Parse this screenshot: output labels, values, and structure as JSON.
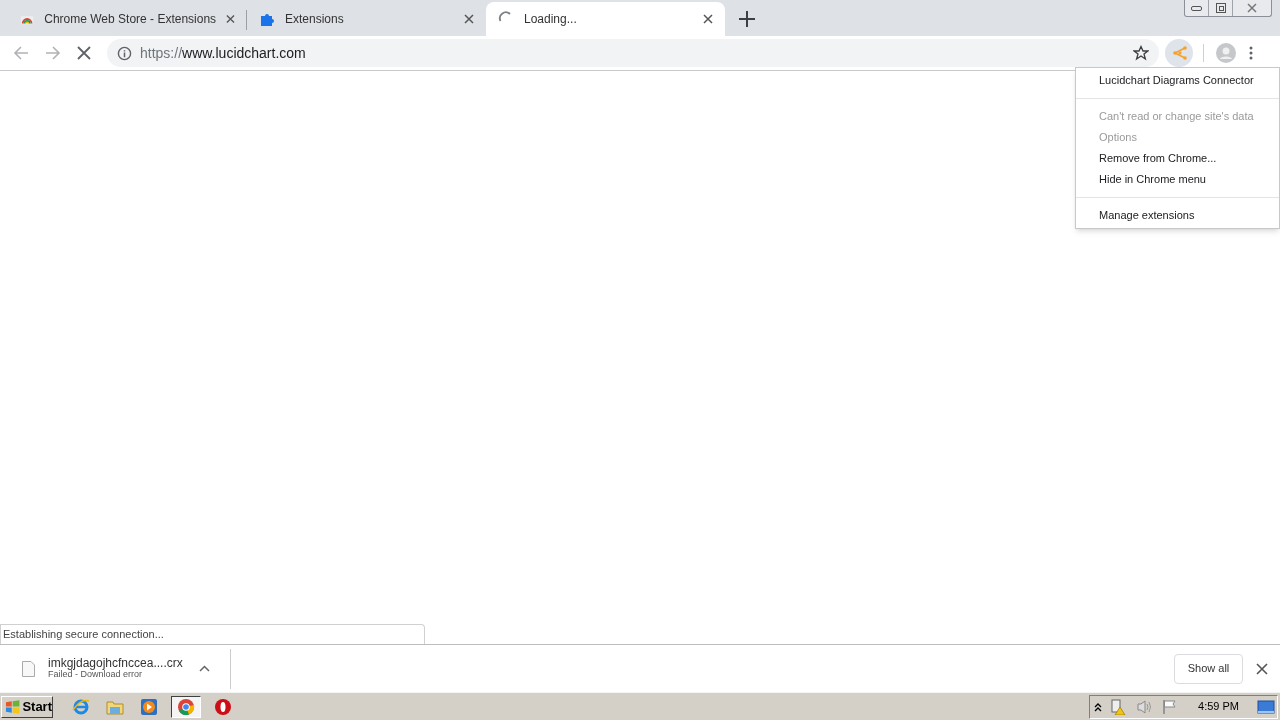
{
  "tabs": [
    {
      "title": "Chrome Web Store - Extensions",
      "kind": "webstore",
      "selected": false
    },
    {
      "title": "Extensions",
      "kind": "puzzle",
      "selected": false
    },
    {
      "title": "Loading...",
      "kind": "loading",
      "selected": true
    }
  ],
  "address_bar": {
    "scheme": "https://",
    "host": "www.lucidchart.com"
  },
  "extension_menu": {
    "groups": [
      [
        {
          "label": "Lucidchart Diagrams Connector",
          "disabled": false
        }
      ],
      [
        {
          "label": "Can't read or change site's data",
          "disabled": true
        },
        {
          "label": "Options",
          "disabled": true
        },
        {
          "label": "Remove from Chrome...",
          "disabled": false
        },
        {
          "label": "Hide in Chrome menu",
          "disabled": false
        }
      ],
      [
        {
          "label": "Manage extensions",
          "disabled": false
        }
      ]
    ]
  },
  "status_bubble": "Establishing secure connection...",
  "download": {
    "filename": "imkgjdagojhcfnccea....crx",
    "status": "Failed - Download error",
    "show_all": "Show all"
  },
  "taskbar": {
    "start": "Start",
    "apps": [
      {
        "kind": "ie",
        "selected": false
      },
      {
        "kind": "folder",
        "selected": false
      },
      {
        "kind": "media",
        "selected": false
      },
      {
        "kind": "chrome",
        "selected": true
      },
      {
        "kind": "opera",
        "selected": false
      }
    ],
    "clock": "4:59 PM"
  }
}
